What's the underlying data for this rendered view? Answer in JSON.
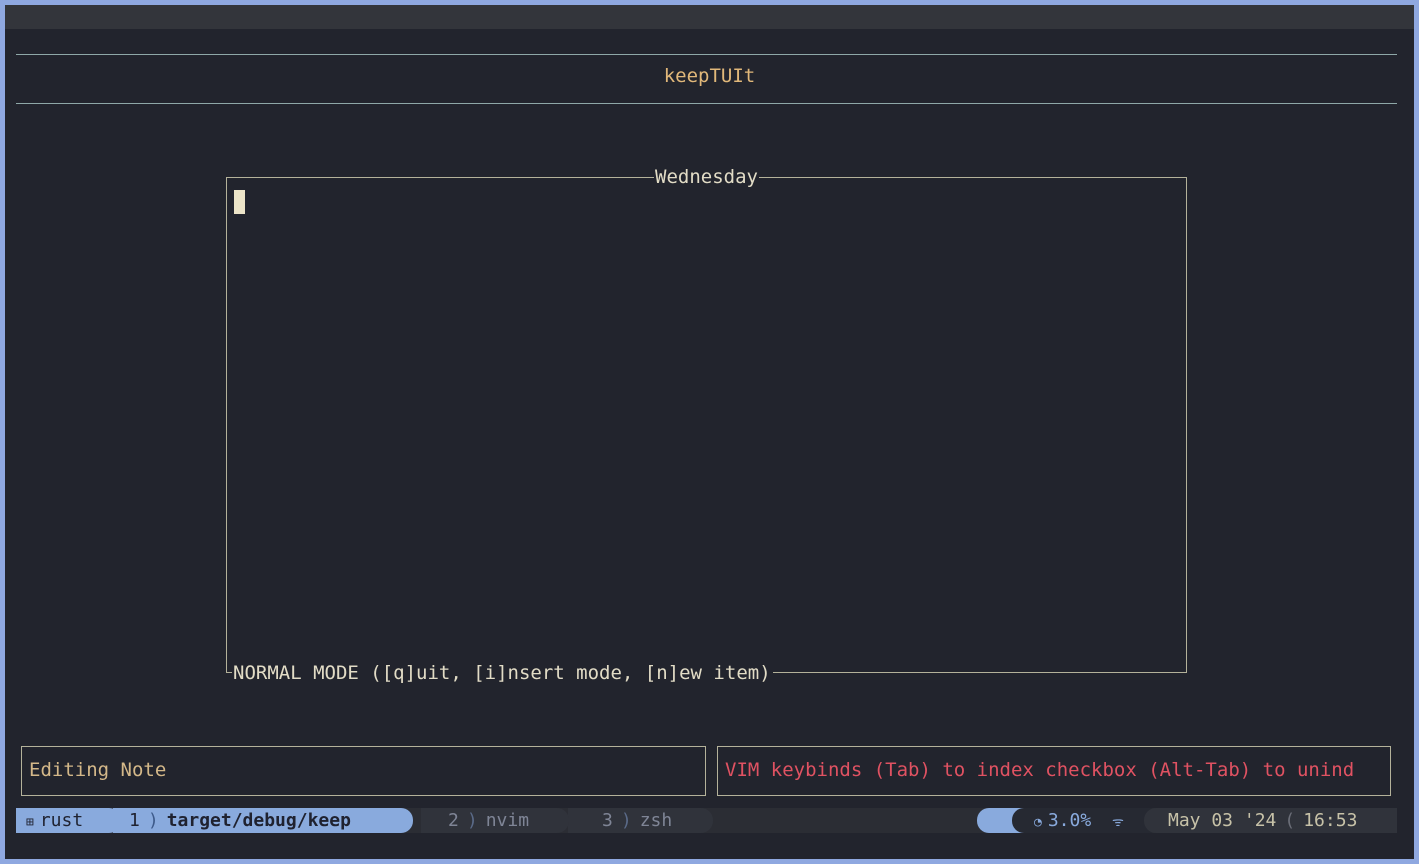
{
  "app": {
    "title": "keepTUIt"
  },
  "note": {
    "title": "Wednesday",
    "mode_hint": "NORMAL MODE ([q]uit, [i]nsert mode, [n]ew item)"
  },
  "status_panels": {
    "left": "Editing Note",
    "right": "VIM keybinds (Tab) to index checkbox (Alt-Tab) to unind"
  },
  "tmux": {
    "session_icon": "grid-icon",
    "session_name": "rust",
    "windows": [
      {
        "index": "1",
        "name": "target/debug/keep",
        "active": true
      },
      {
        "index": "2",
        "name": "nvim",
        "active": false
      },
      {
        "index": "3",
        "name": "zsh",
        "active": false
      }
    ],
    "cpu": "3.0%",
    "date": "May 03 '24",
    "time": "16:53"
  },
  "colors": {
    "background": "#22242d",
    "accent": "#89aadd",
    "title": "#e1b87a",
    "warning": "#e05262",
    "border": "#b4b29a"
  }
}
